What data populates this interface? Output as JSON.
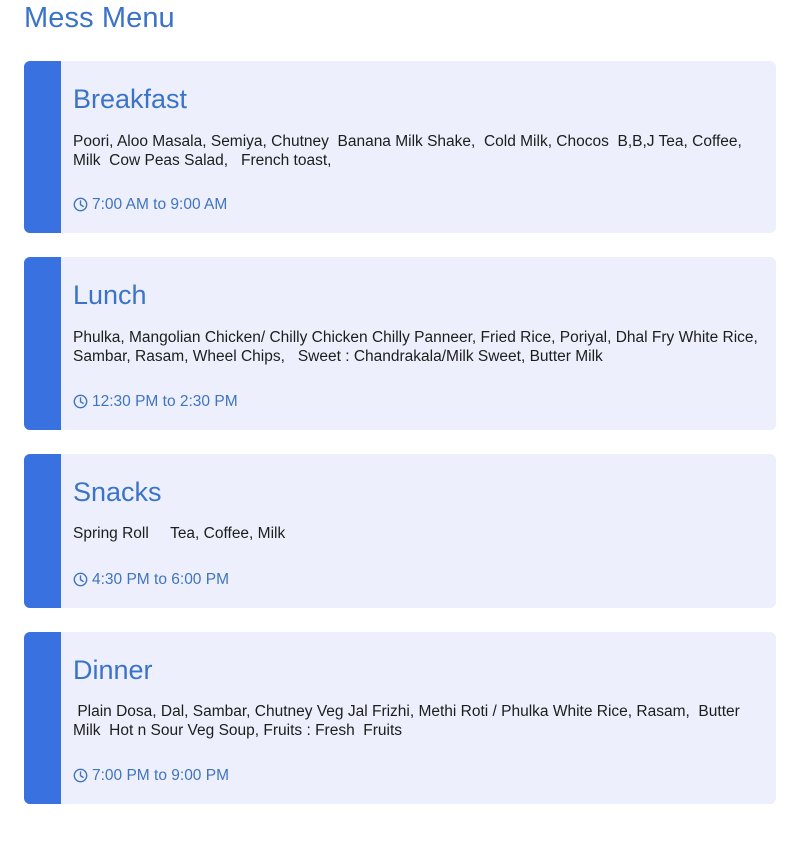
{
  "page": {
    "title": "Mess Menu"
  },
  "colors": {
    "accent": "#3a71e0",
    "title_blue": "#3a73c9",
    "card_background": "#edf0fc",
    "text": "#1d1d1d"
  },
  "meals": [
    {
      "title": "Breakfast",
      "items": "Poori, Aloo Masala, Semiya, Chutney  Banana Milk Shake,  Cold Milk, Chocos  B,B,J Tea, Coffee, Milk  Cow Peas Salad,   French toast,",
      "time": "7:00 AM to 9:00 AM",
      "icon": "clock-icon"
    },
    {
      "title": "Lunch",
      "items": "Phulka, Mangolian Chicken/ Chilly Chicken Chilly Panneer, Fried Rice, Poriyal, Dhal Fry White Rice, Sambar, Rasam, Wheel Chips,   Sweet : Chandrakala/Milk Sweet, Butter Milk",
      "time": "12:30 PM to 2:30 PM",
      "icon": "clock-icon"
    },
    {
      "title": "Snacks",
      "items": "Spring Roll     Tea, Coffee, Milk",
      "time": "4:30 PM to 6:00 PM",
      "icon": "clock-icon"
    },
    {
      "title": "Dinner",
      "items": " Plain Dosa, Dal, Sambar, Chutney Veg Jal Frizhi, Methi Roti / Phulka White Rice, Rasam,  Butter Milk  Hot n Sour Veg Soup, Fruits : Fresh  Fruits",
      "time": "7:00 PM to 9:00 PM",
      "icon": "clock-icon"
    }
  ]
}
